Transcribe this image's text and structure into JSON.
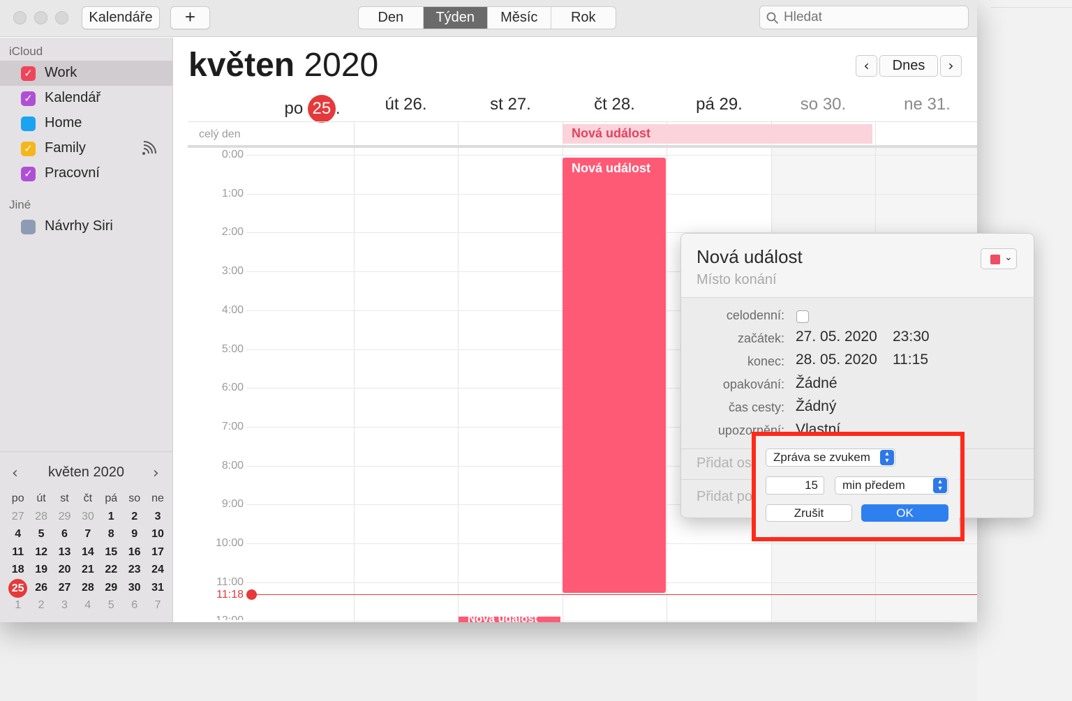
{
  "toolbar": {
    "calendars_label": "Kalendáře",
    "add_label": "+",
    "views": [
      "Den",
      "Týden",
      "Měsíc",
      "Rok"
    ],
    "active_view": "Týden",
    "search_placeholder": "Hledat"
  },
  "sidebar": {
    "icloud_header": "iCloud",
    "calendars": [
      {
        "name": "Work",
        "color": "#f0445a",
        "checked": true,
        "selected": true
      },
      {
        "name": "Kalendář",
        "color": "#b04fd6",
        "checked": true
      },
      {
        "name": "Home",
        "color": "#1aa3f1",
        "checked": false
      },
      {
        "name": "Family",
        "color": "#f5b61c",
        "checked": true,
        "shared": true
      },
      {
        "name": "Pracovní",
        "color": "#b04fd6",
        "checked": true
      }
    ],
    "other_header": "Jiné",
    "other_calendars": [
      {
        "name": "Návrhy Siri",
        "color": "#8e9bb4",
        "checked": false
      }
    ]
  },
  "mini_calendar": {
    "title": "květen 2020",
    "weekdays": [
      "po",
      "út",
      "st",
      "čt",
      "pá",
      "so",
      "ne"
    ],
    "weeks": [
      [
        "27",
        "28",
        "29",
        "30",
        "1",
        "2",
        "3"
      ],
      [
        "4",
        "5",
        "6",
        "7",
        "8",
        "9",
        "10"
      ],
      [
        "11",
        "12",
        "13",
        "14",
        "15",
        "16",
        "17"
      ],
      [
        "18",
        "19",
        "20",
        "21",
        "22",
        "23",
        "24"
      ],
      [
        "25",
        "26",
        "27",
        "28",
        "29",
        "30",
        "31"
      ],
      [
        "1",
        "2",
        "3",
        "4",
        "5",
        "6",
        "7"
      ]
    ],
    "today": "25"
  },
  "main": {
    "month": "květen",
    "year": "2020",
    "today_button": "Dnes",
    "days": [
      {
        "name": "po",
        "num": "25",
        "suffix": ".",
        "today": true
      },
      {
        "label": "út 26."
      },
      {
        "label": "st 27."
      },
      {
        "label": "čt 28."
      },
      {
        "label": "pá 29."
      },
      {
        "label": "so 30.",
        "weekend": true
      },
      {
        "label": "ne 31.",
        "weekend": true
      }
    ],
    "allday_label": "celý den",
    "hours": [
      "0:00",
      "1:00",
      "2:00",
      "3:00",
      "4:00",
      "5:00",
      "6:00",
      "7:00",
      "8:00",
      "9:00",
      "10:00",
      "11:00",
      "12:00"
    ],
    "current_time": "11:18",
    "event_title": "Nová událost"
  },
  "popover": {
    "title": "Nová událost",
    "location_placeholder": "Místo konání",
    "fields": {
      "allday_label": "celodenní:",
      "start_label": "začátek:",
      "start_date": "27. 05. 2020",
      "start_time": "23:30",
      "end_label": "konec:",
      "end_date": "28. 05. 2020",
      "end_time": "11:15",
      "repeat_label": "opakování:",
      "repeat_value": "Žádné",
      "travel_label": "čas cesty:",
      "travel_value": "Žádný",
      "alert_label": "upozornění:",
      "alert_value": "Vlastní"
    },
    "add_invitees": "Přidat osoby",
    "add_notes": "Přidat poznámky",
    "color": "#ee4d62"
  },
  "alert_panel": {
    "type": "Zpráva se zvukem",
    "amount": "15",
    "unit": "min předem",
    "cancel": "Zrušit",
    "ok": "OK",
    "highlight_color": "#ff2a1a"
  }
}
